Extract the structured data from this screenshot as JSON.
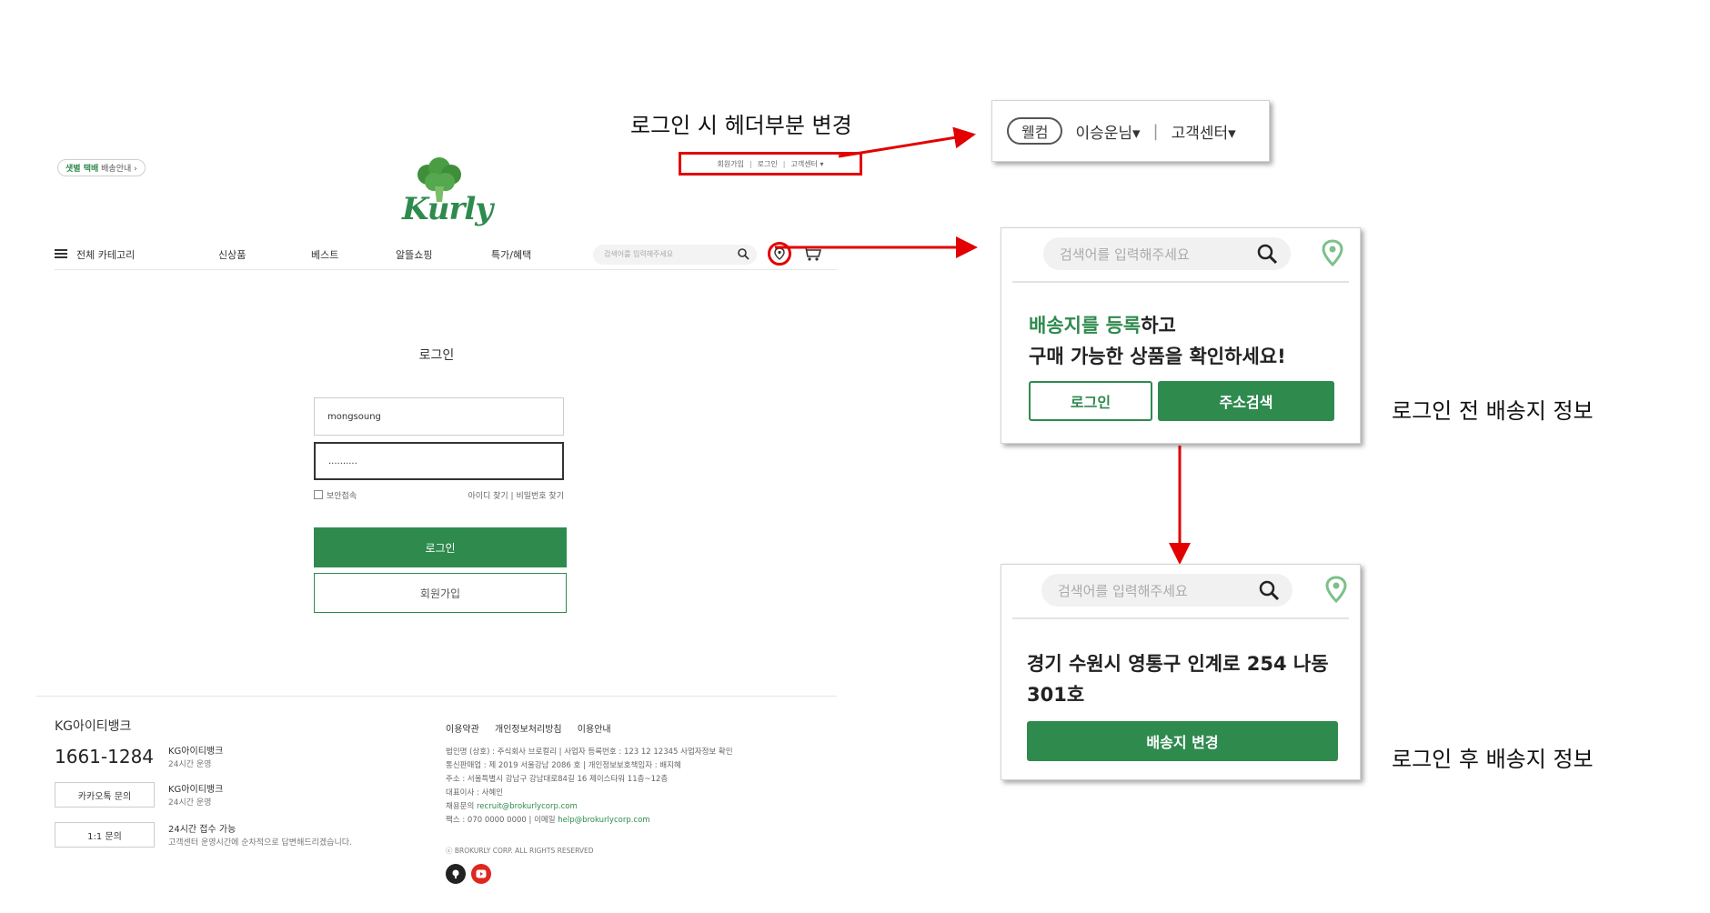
{
  "annotations": {
    "header_change": "로그인 시 헤더부분 변경",
    "before_login": "로그인 전 배송지 정보",
    "after_login": "로그인 후 배송지 정보"
  },
  "site": {
    "top_badge_highlight": "샛별 택배",
    "top_badge_rest": "배송안내",
    "logo_text": "Kurly",
    "util_links": [
      "회원가입",
      "로그인",
      "고객센터 ▾"
    ]
  },
  "nav": {
    "all_category": "전체 카테고리",
    "items": [
      "신상품",
      "베스트",
      "알뜰쇼핑",
      "특가/혜택"
    ],
    "search_placeholder": "검색어를 입력해주세요"
  },
  "login": {
    "title": "로그인",
    "id_value": "mongsoung",
    "pw_value": "..........",
    "secure_label": "보안접속",
    "find_links": "아이디 찾기 | 비밀번호 찾기",
    "login_button": "로그인",
    "signup_button": "회원가입"
  },
  "footer": {
    "title": "KG아이티뱅크",
    "phone": "1661-1284",
    "phone_info_title": "KG아이티뱅크",
    "phone_info_sub": "24시간 운영",
    "kakao_button": "카카오톡 문의",
    "kakao_info_title": "KG아이티뱅크",
    "kakao_info_sub": "24시간 운영",
    "inquiry_button": "1:1 문의",
    "inquiry_info_title": "24시간 접수 가능",
    "inquiry_info_sub": "고객센터 운영시간에 순차적으로 답변해드리겠습니다.",
    "links": [
      "이용약관",
      "개인정보처리방침",
      "이용안내"
    ],
    "corp_lines": [
      "법인명 (상호) : 주식회사 브로컬리 | 사업자 등록번호 : 123 12 12345 사업자정보 확인",
      "통신판매업 : 제 2019 서울강남 2086 호 | 개인정보보호책임자 : 배지혜",
      "주소 : 서울특별시 강남구 강남대로84길 16 제이스타워 11층~12층",
      "대표이사 : 사혜인"
    ],
    "recruit_label": "채용문의",
    "recruit_email": "recruit@brokurlycorp.com",
    "fax_label": "팩스 : 070 0000 0000 | 이메일",
    "help_email": "help@brokurlycorp.com",
    "copyright": "ⓒ BROKURLY CORP. ALL RIGHTS RESERVED"
  },
  "header_popup": {
    "welcome_badge": "웰컴",
    "user_menu": "이승운님▾",
    "cs_menu": "고객센터▾"
  },
  "before_popup": {
    "search_placeholder": "검색어를 입력해주세요",
    "msg_green": "배송지를 등록",
    "msg_rest": "하고",
    "msg_line2": "구매 가능한 상품을 확인하세요!",
    "login_button": "로그인",
    "address_button": "주소검색"
  },
  "after_popup": {
    "search_placeholder": "검색어를 입력해주세요",
    "address_line1": "경기 수원시 영통구 인계로 254 나동",
    "address_line2": "301호",
    "change_button": "배송지 변경"
  },
  "colors": {
    "brand": "#2f8a4e",
    "annotation_red": "#e20000"
  }
}
